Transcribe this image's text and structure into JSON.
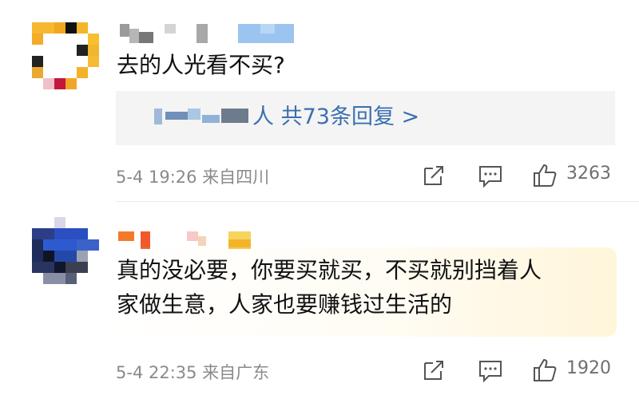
{
  "comments": [
    {
      "text": "去的人光看不买?",
      "reply": {
        "summary": "人  共73条回复 >"
      },
      "meta": "5-4 19:26  来自四川",
      "likes": "3263",
      "actions": [
        "share-icon",
        "comment-icon",
        "like-icon"
      ]
    },
    {
      "text_line1": "真的没必要，你要买就买，不买就别挡着人",
      "text_line2": "家做生意，人家也要赚钱过生活的",
      "meta": "5-4 22:35  来自广东",
      "likes": "1920",
      "actions": [
        "share-icon",
        "comment-icon",
        "like-icon"
      ]
    }
  ],
  "colors": {
    "link": "#3b6fb0",
    "meta": "#8a8a8a",
    "reply_bg": "#f4f4f4"
  }
}
